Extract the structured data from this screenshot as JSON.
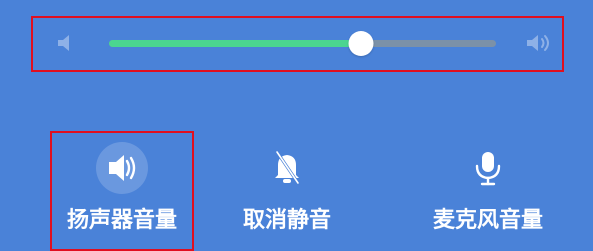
{
  "app": {
    "background": "#4a82d8",
    "highlight_color": "#e00f1f"
  },
  "volume_control": {
    "value_percent": 65,
    "track_color": "#7b91a8",
    "fill_color": "#4bd590",
    "thumb_color": "#ffffff",
    "left_icon": "volume-low-icon",
    "right_icon": "volume-high-icon"
  },
  "modes": [
    {
      "id": "speaker",
      "label": "扬声器音量",
      "icon": "speaker-icon",
      "selected": true
    },
    {
      "id": "unmute",
      "label": "取消静音",
      "icon": "bell-muted-icon",
      "selected": false
    },
    {
      "id": "mic",
      "label": "麦克风音量",
      "icon": "microphone-icon",
      "selected": false
    }
  ]
}
